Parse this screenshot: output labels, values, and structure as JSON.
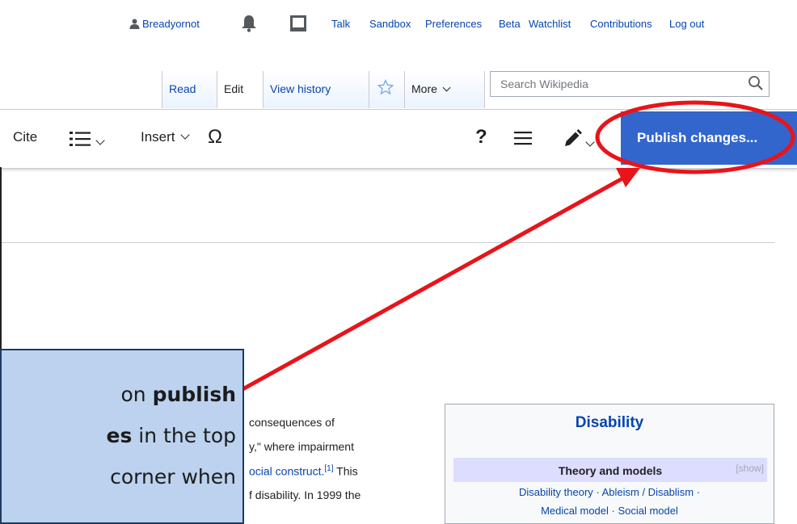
{
  "personal": {
    "username": "Breadyornot",
    "links": [
      "Talk",
      "Sandbox",
      "Preferences",
      "Beta",
      "Watchlist",
      "Contributions",
      "Log out"
    ]
  },
  "tabs": {
    "read": "Read",
    "edit": "Edit",
    "view_history": "View history",
    "more": "More",
    "search_placeholder": "Search Wikipedia"
  },
  "toolbar": {
    "cite": "Cite",
    "insert": "Insert",
    "special_char": "Ω",
    "help": "?",
    "publish": "Publish changes..."
  },
  "article": {
    "line1": "consequences of",
    "line2_a": "y,\" where impairment",
    "line3_link": "ocial construct.",
    "line3_ref": "[1]",
    "line3_tail": " This",
    "line4": "f disability. In 1999 the"
  },
  "navbox": {
    "title": "Disability",
    "group_title": "Theory and models",
    "show": "[show]",
    "line1": "Disability theory · Ableism / Disablism ·",
    "line2": "Medical model · Social model"
  },
  "callout": {
    "line1_pre": "on ",
    "line1_bold": "publish",
    "line2_bold": "es",
    "line2_post": " in the top",
    "line3": "corner when"
  },
  "colors": {
    "accent": "#3366cc",
    "annotation": "#e8141a",
    "callout_bg": "#bcd2ee"
  }
}
